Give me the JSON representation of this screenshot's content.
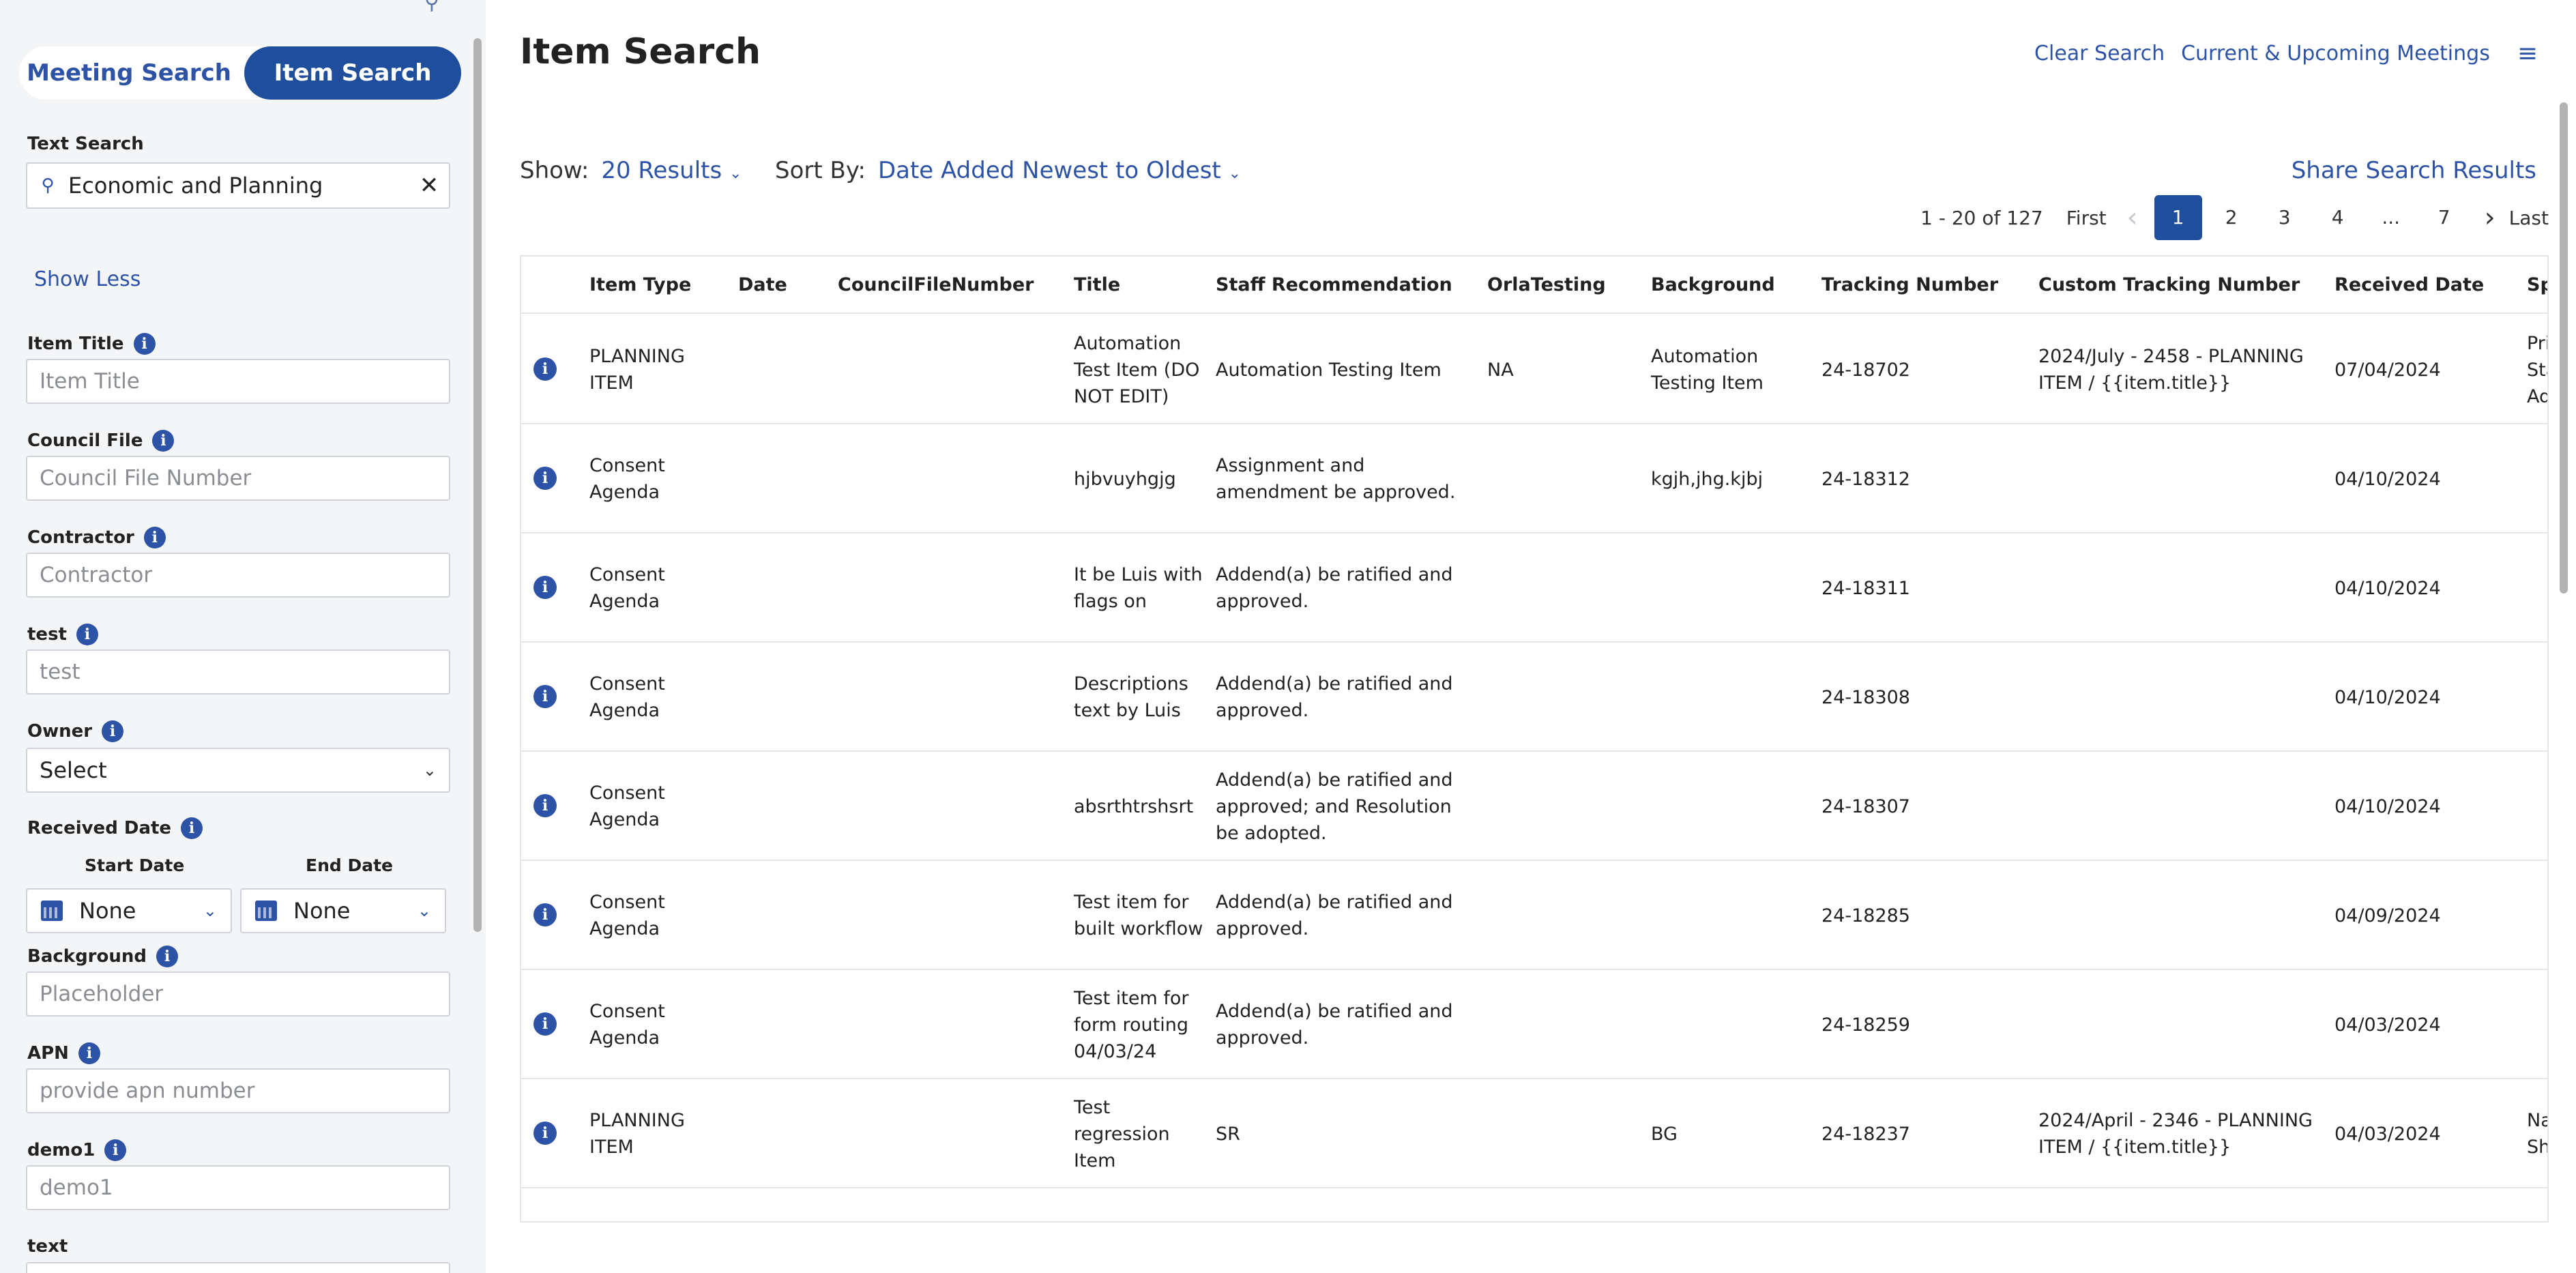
{
  "sidebar": {
    "tabs": {
      "meeting": "Meeting Search",
      "item": "Item Search"
    },
    "text_search": {
      "label": "Text Search",
      "value": "Economic and Planning"
    },
    "show_less": "Show Less",
    "fields": [
      {
        "label": "Item Title",
        "placeholder": "Item Title"
      },
      {
        "label": "Council File",
        "placeholder": "Council File Number"
      },
      {
        "label": "Contractor",
        "placeholder": "Contractor"
      },
      {
        "label": "test",
        "placeholder": "test"
      }
    ],
    "owner": {
      "label": "Owner",
      "value": "Select"
    },
    "received_date": {
      "label": "Received Date",
      "start_label": "Start Date",
      "end_label": "End Date",
      "start_value": "None",
      "end_value": "None"
    },
    "fields2": [
      {
        "label": "Background",
        "placeholder": "Placeholder"
      },
      {
        "label": "APN",
        "placeholder": "provide apn number"
      },
      {
        "label": "demo1",
        "placeholder": "demo1"
      }
    ],
    "text_label": "text"
  },
  "main": {
    "title": "Item Search",
    "links": {
      "clear": "Clear Search",
      "meetings": "Current & Upcoming Meetings"
    },
    "show": {
      "label": "Show:",
      "value": "20 Results"
    },
    "sort": {
      "label": "Sort By:",
      "value": "Date Added Newest to Oldest"
    },
    "share": "Share Search Results",
    "pager": {
      "range": "1 - 20 of 127",
      "first": "First",
      "pages": [
        "1",
        "2",
        "3",
        "4",
        "...",
        "7"
      ],
      "last": "Last"
    },
    "columns": [
      "Item Type",
      "Date",
      "CouncilFileNumber",
      "Title",
      "Staff Recommendation",
      "OrlaTesting",
      "Background",
      "Tracking Number",
      "Custom Tracking Number",
      "Received Date",
      "Sp"
    ],
    "rows": [
      {
        "type": "PLANNING ITEM",
        "date": "",
        "cfn": "",
        "title": "Automation Test Item (DO NOT EDIT)",
        "staff": "Automation Testing Item",
        "orla": "NA",
        "background": "Automation Testing Item",
        "tracking": "24-18702",
        "custom": "2024/July - 2458 - PLANNING ITEM / {{item.title}}",
        "received": "07/04/2024",
        "sp": "Pri Sta Ad"
      },
      {
        "type": "Consent Agenda",
        "date": "",
        "cfn": "",
        "title": "hjbvuyhgjg",
        "staff": "Assignment and amendment be approved.",
        "orla": "",
        "background": "kgjh,jhg.kjbj",
        "tracking": "24-18312",
        "custom": "",
        "received": "04/10/2024",
        "sp": ""
      },
      {
        "type": "Consent Agenda",
        "date": "",
        "cfn": "",
        "title": "It be Luis with flags on",
        "staff": "Addend(a) be ratified and approved.",
        "orla": "",
        "background": "",
        "tracking": "24-18311",
        "custom": "",
        "received": "04/10/2024",
        "sp": ""
      },
      {
        "type": "Consent Agenda",
        "date": "",
        "cfn": "",
        "title": "Descriptions text by Luis",
        "staff": "Addend(a) be ratified and approved.",
        "orla": "",
        "background": "",
        "tracking": "24-18308",
        "custom": "",
        "received": "04/10/2024",
        "sp": ""
      },
      {
        "type": "Consent Agenda",
        "date": "",
        "cfn": "",
        "title": "absrthtrshsrt",
        "staff": "Addend(a) be ratified and approved; and Resolution be adopted.",
        "orla": "",
        "background": "",
        "tracking": "24-18307",
        "custom": "",
        "received": "04/10/2024",
        "sp": ""
      },
      {
        "type": "Consent Agenda",
        "date": "",
        "cfn": "",
        "title": "Test item for built workflow",
        "staff": "Addend(a) be ratified and approved.",
        "orla": "",
        "background": "",
        "tracking": "24-18285",
        "custom": "",
        "received": "04/09/2024",
        "sp": ""
      },
      {
        "type": "Consent Agenda",
        "date": "",
        "cfn": "",
        "title": "Test item for form routing 04/03/24",
        "staff": "Addend(a) be ratified and approved.",
        "orla": "",
        "background": "",
        "tracking": "24-18259",
        "custom": "",
        "received": "04/03/2024",
        "sp": ""
      },
      {
        "type": "PLANNING ITEM",
        "date": "",
        "cfn": "",
        "title": "Test regression Item",
        "staff": "SR",
        "orla": "",
        "background": "BG",
        "tracking": "24-18237",
        "custom": "2024/April - 2346 - PLANNING ITEM / {{item.title}}",
        "received": "04/03/2024",
        "sp": "Na Sh"
      }
    ]
  },
  "icons": {
    "info": "info-icon",
    "search": "search-icon",
    "clear": "close-icon",
    "calendar": "calendar-icon",
    "menu": "hamburger-menu-icon"
  },
  "colors": {
    "accent": "#1f4f9c",
    "link": "#2d53a6",
    "sidebar_bg": "#f4f5f7"
  }
}
